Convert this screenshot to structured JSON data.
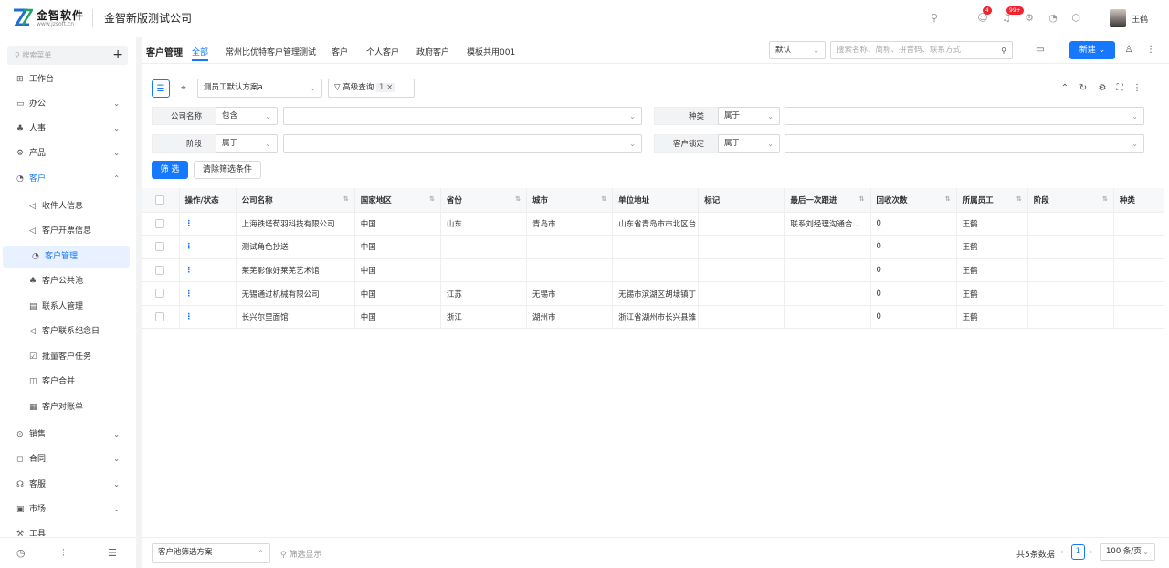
{
  "header": {
    "logo_text": "金智软件",
    "logo_sub": "www.jzsoft.cn",
    "company": "金智新版测试公司",
    "badge_1": "4",
    "badge_2": "99+",
    "user": "王鹤"
  },
  "sidebar": {
    "search_placeholder": "搜索菜单",
    "items": [
      {
        "label": "工作台",
        "icon": "⊞"
      },
      {
        "label": "办公",
        "icon": "▭"
      },
      {
        "label": "人事",
        "icon": "♣"
      },
      {
        "label": "产品",
        "icon": "⚙"
      },
      {
        "label": "客户",
        "icon": "◔"
      }
    ],
    "subitems": [
      "收件人信息",
      "客户开票信息",
      "客户管理",
      "客户公共池",
      "联系人管理",
      "客户联系纪念日",
      "批量客户任务",
      "客户合并",
      "客户对账单"
    ],
    "bottom_items": [
      {
        "label": "销售",
        "icon": "⊙"
      },
      {
        "label": "合同",
        "icon": "◻"
      },
      {
        "label": "客服",
        "icon": "☊"
      },
      {
        "label": "市场",
        "icon": "▣"
      },
      {
        "label": "工具",
        "icon": "⚒"
      }
    ]
  },
  "tabs": {
    "title": "客户管理",
    "items": [
      "全部",
      "常州比优特客户管理测试",
      "客户",
      "个人客户",
      "政府客户",
      "模板共用001"
    ],
    "view": "默认",
    "search_placeholder": "搜索名称、简称、拼音码、联系方式",
    "new_label": "新建"
  },
  "filter": {
    "scheme": "测员工默认方案a",
    "advanced": "高级查询",
    "advanced_count": "1 ×",
    "label_company": "公司名称",
    "op_company": "包含",
    "label_type": "种类",
    "op_type": "属于",
    "label_stage": "阶段",
    "op_stage": "属于",
    "label_lock": "客户锁定",
    "op_lock": "属于",
    "btn_filter": "筛 选",
    "btn_clear": "清除筛选条件"
  },
  "table": {
    "columns": [
      "操作/状态",
      "公司名称",
      "国家地区",
      "省份",
      "城市",
      "单位地址",
      "标记",
      "最后一次跟进",
      "回收次数",
      "所属员工",
      "阶段",
      "种类"
    ],
    "rows": [
      [
        "上海铁塔荀羽科技有限公司",
        "中国",
        "山东",
        "青岛市",
        "山东省青岛市市北区台",
        "",
        "联系刘经理沟通合…",
        "0",
        "王鹤",
        "",
        ""
      ],
      [
        "测试角色抄送",
        "中国",
        "",
        "",
        "",
        "",
        "",
        "0",
        "王鹤",
        "",
        ""
      ],
      [
        "莱芜影像好莱芜艺术馆",
        "中国",
        "",
        "",
        "",
        "",
        "",
        "0",
        "王鹤",
        "",
        ""
      ],
      [
        "无锡通过机械有限公司",
        "中国",
        "江苏",
        "无锡市",
        "无锡市滨湖区胡埭镇丁",
        "",
        "",
        "0",
        "王鹤",
        "",
        ""
      ],
      [
        "长兴尔里面馆",
        "中国",
        "浙江",
        "湖州市",
        "浙江省湖州市长兴县雉",
        "",
        "",
        "0",
        "王鹤",
        "",
        ""
      ]
    ]
  },
  "footer": {
    "pool_scheme": "客户池筛选方案",
    "filter_show": "筛选显示",
    "total": "共5条数据",
    "page": "1",
    "page_size": "100 条/页"
  }
}
